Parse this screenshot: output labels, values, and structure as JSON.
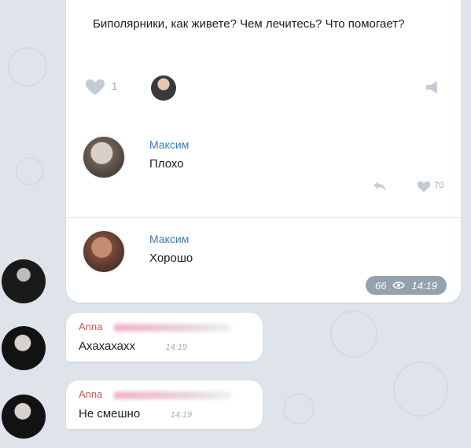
{
  "post": {
    "text": "Биполярники, как живете? Чем лечитесь? Что помогает?",
    "like_count": "1",
    "like_icon": "heart-icon",
    "share_icon": "share-icon"
  },
  "comments": [
    {
      "name": "Максим",
      "text": "Плохо",
      "likes": "70"
    },
    {
      "name": "Максим",
      "text": "Хорошо"
    }
  ],
  "forward_meta": {
    "views": "66",
    "time": "14:19"
  },
  "messages": [
    {
      "sender": "Anna",
      "text": "Ахахахахх",
      "time": "14:19"
    },
    {
      "sender": "Anna",
      "text": "Не смешно",
      "time": "14:19"
    }
  ],
  "colors": {
    "name_blue": "#3d7ab5",
    "sender_red": "#d9534f",
    "background": "#dfe3ea",
    "meta_pill": "#95a1ab"
  }
}
